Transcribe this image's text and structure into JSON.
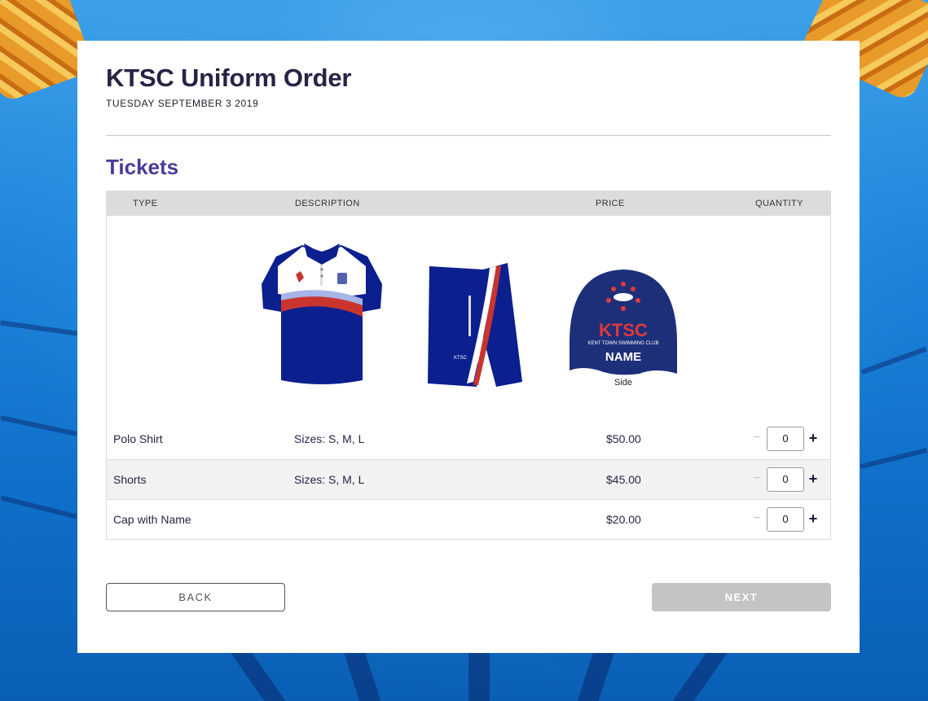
{
  "page": {
    "title": "KTSC Uniform Order",
    "date": "TUESDAY SEPTEMBER 3 2019",
    "section_heading": "Tickets"
  },
  "table": {
    "headers": {
      "type": "TYPE",
      "description": "DESCRIPTION",
      "price": "PRICE",
      "quantity": "QUANTITY"
    },
    "cap_image": {
      "brand": "KTSC",
      "club": "KENT TOWN SWIMMING CLUB",
      "name": "NAME",
      "caption": "Side"
    },
    "rows": [
      {
        "type": "Polo Shirt",
        "description": "Sizes: S, M, L",
        "price": "$50.00",
        "quantity": "0"
      },
      {
        "type": "Shorts",
        "description": "Sizes: S, M, L",
        "price": "$45.00",
        "quantity": "0"
      },
      {
        "type": "Cap with Name",
        "description": "",
        "price": "$20.00",
        "quantity": "0"
      }
    ],
    "qty_minus": "−",
    "qty_plus": "+"
  },
  "buttons": {
    "back": "BACK",
    "next": "NEXT"
  },
  "colors": {
    "title": "#2a2245",
    "section_heading": "#4a3a9a",
    "uniform_navy": "#0b1f8f",
    "next_disabled": "#c4c4c4"
  },
  "icons": {
    "minus": "minus-icon",
    "plus": "plus-icon"
  }
}
